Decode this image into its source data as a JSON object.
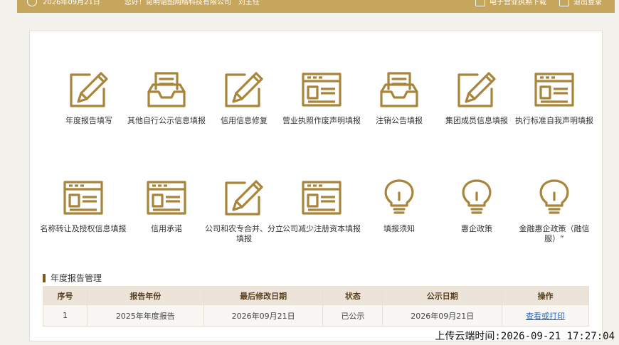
{
  "topbar": {
    "date": "2026年09月21日",
    "greeting": "您好！昆明语图网络科技有限公司　刘主任",
    "license_download": "电子营业执照下载",
    "logout": "退出登录"
  },
  "tiles": [
    {
      "label": "年度报告填写",
      "icon": "pen-doc-icon"
    },
    {
      "label": "其他自行公示信息填报",
      "icon": "inbox-doc-icon"
    },
    {
      "label": "信用信息修复",
      "icon": "pen-doc-icon"
    },
    {
      "label": "营业执照作废声明填报",
      "icon": "form-card-icon"
    },
    {
      "label": "注销公告填报",
      "icon": "inbox-doc-icon"
    },
    {
      "label": "集团成员信息填报",
      "icon": "pen-doc-icon"
    },
    {
      "label": "执行标准自我声明填报",
      "icon": "form-card-icon"
    },
    {
      "label": "名称转让及授权信息填报",
      "icon": "form-card-icon"
    },
    {
      "label": "信用承诺",
      "icon": "form-card-icon"
    },
    {
      "label": "公司和农专合并、分立填报",
      "icon": "pen-doc-icon"
    },
    {
      "label": "公司减少注册资本填报",
      "icon": "form-card-icon"
    },
    {
      "label": "填报须知",
      "icon": "lightbulb-icon"
    },
    {
      "label": "惠企政策",
      "icon": "lightbulb-icon"
    },
    {
      "label": "金融惠企政策（融信服）“",
      "icon": "lightbulb-icon"
    }
  ],
  "section": {
    "title": "年度报告管理"
  },
  "table": {
    "headers": [
      "序号",
      "报告年份",
      "最后修改日期",
      "状态",
      "公示日期",
      "操作"
    ],
    "rows": [
      [
        "1",
        "2025年年度报告",
        "2026年09月21日",
        "已公示",
        "2026年09月21日",
        "查看或打印"
      ]
    ]
  },
  "footer_stamp": "上传云端时间:2026-09-21 17:27:04",
  "colors": {
    "accent": "#a8853a",
    "topbar": "#c6a55c",
    "link": "#2a66b8"
  }
}
